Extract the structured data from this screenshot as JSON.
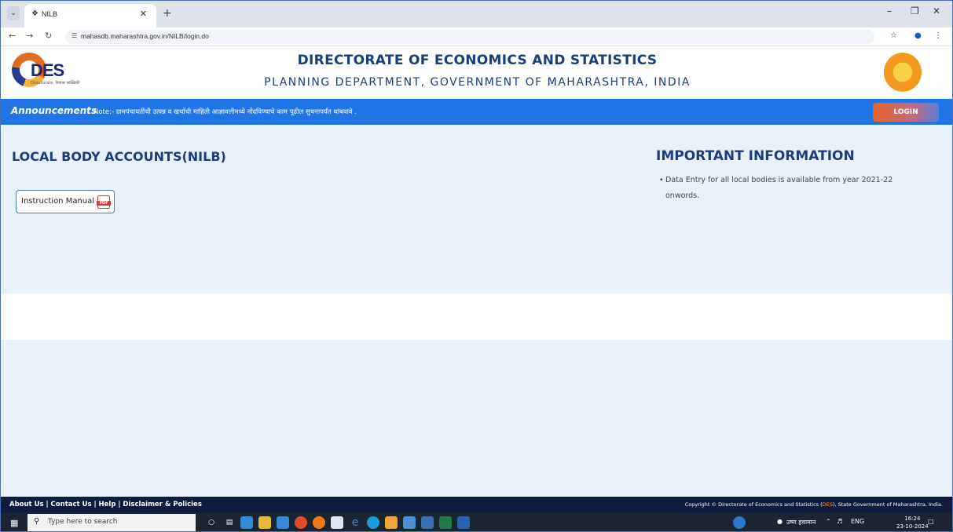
{
  "browser": {
    "tab_title": "NILB",
    "new_tab": "+",
    "url": "mahasdb.maharashtra.gov.in/NILB/login.do"
  },
  "header": {
    "logo_text": "DES",
    "logo_subtext": "Directorate: विकास सांख्यिकी",
    "title": "DIRECTORATE OF ECONOMICS AND STATISTICS",
    "subtitle": "PLANNING DEPARTMENT, GOVERNMENT OF MAHARASHTRA, INDIA"
  },
  "announcement": {
    "label": "Announcements",
    "text": "Note:- ग्रामपंचायतींची उत्पन्न व खर्चाची माहिती आज्ञावलीमध्ये नोंदविण्याचे काम पूढील सुचनापर्यंत थांबवावे ."
  },
  "login_label": "LOGIN",
  "main": {
    "left_title": "LOCAL BODY ACCOUNTS(NILB)",
    "manual_label": "Instruction Manual",
    "right_title": "IMPORTANT INFORMATION",
    "info_items": [
      "Data Entry for all local bodies is available from year 2021-22 onwords."
    ]
  },
  "footer": {
    "links": "About Us | Contact Us | Help | Disclaimer & Policies",
    "copyright_pre": "Copyright © Directorate of Economics and Statistics (",
    "copyright_abbr": "DES",
    "copyright_post": "), State Government of Maharashtra, India."
  },
  "taskbar": {
    "search_placeholder": "Type here to search",
    "weather": "उष्ण हवामान",
    "lang": "ENG",
    "time": "16:24",
    "date": "23-10-2024"
  },
  "colors": {
    "announce_bg": "#1f74e6",
    "title_blue": "#1a3d7c",
    "content_bg": "#e8f1fa",
    "footer_bg": "#0f1c3d"
  }
}
